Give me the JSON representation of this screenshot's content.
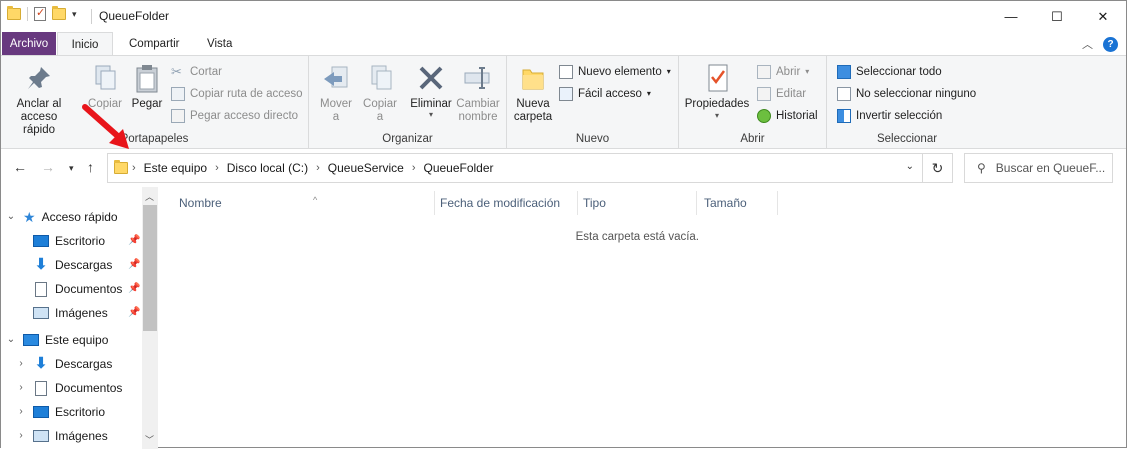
{
  "window": {
    "title": "QueueFolder"
  },
  "ribbon_tabs": [
    "Archivo",
    "Inicio",
    "Compartir",
    "Vista"
  ],
  "ribbon": {
    "portapapeles": {
      "label": "Portapapeles",
      "pin": "Anclar al\nacceso rápido",
      "copy": "Copiar",
      "paste": "Pegar",
      "cut": "Cortar",
      "copy_path": "Copiar ruta de acceso",
      "paste_shortcut": "Pegar acceso directo"
    },
    "organizar": {
      "label": "Organizar",
      "move": "Mover\na",
      "copy_to": "Copiar\na",
      "delete": "Eliminar",
      "rename": "Cambiar\nnombre"
    },
    "nuevo": {
      "label": "Nuevo",
      "new_folder": "Nueva\ncarpeta",
      "new_item": "Nuevo elemento",
      "easy_access": "Fácil acceso"
    },
    "abrir": {
      "label": "Abrir",
      "properties": "Propiedades",
      "open": "Abrir",
      "edit": "Editar",
      "history": "Historial"
    },
    "seleccionar": {
      "label": "Seleccionar",
      "select_all": "Seleccionar todo",
      "select_none": "No seleccionar ninguno",
      "invert": "Invertir selección"
    }
  },
  "address": {
    "crumbs": [
      "Este equipo",
      "Disco local (C:)",
      "QueueService",
      "QueueFolder"
    ],
    "search_placeholder": "Buscar en QueueF..."
  },
  "nav": {
    "quick_access": "Acceso rápido",
    "quick_items": [
      "Escritorio",
      "Descargas",
      "Documentos",
      "Imágenes"
    ],
    "this_pc": "Este equipo",
    "pc_items": [
      "Descargas",
      "Documentos",
      "Escritorio",
      "Imágenes"
    ]
  },
  "columns": [
    "Nombre",
    "Fecha de modificación",
    "Tipo",
    "Tamaño"
  ],
  "empty_message": "Esta carpeta está vacía.",
  "colors": {
    "file_tab": "#68397f",
    "accent_arrow": "#e8141a",
    "folder": "#ffd867"
  }
}
